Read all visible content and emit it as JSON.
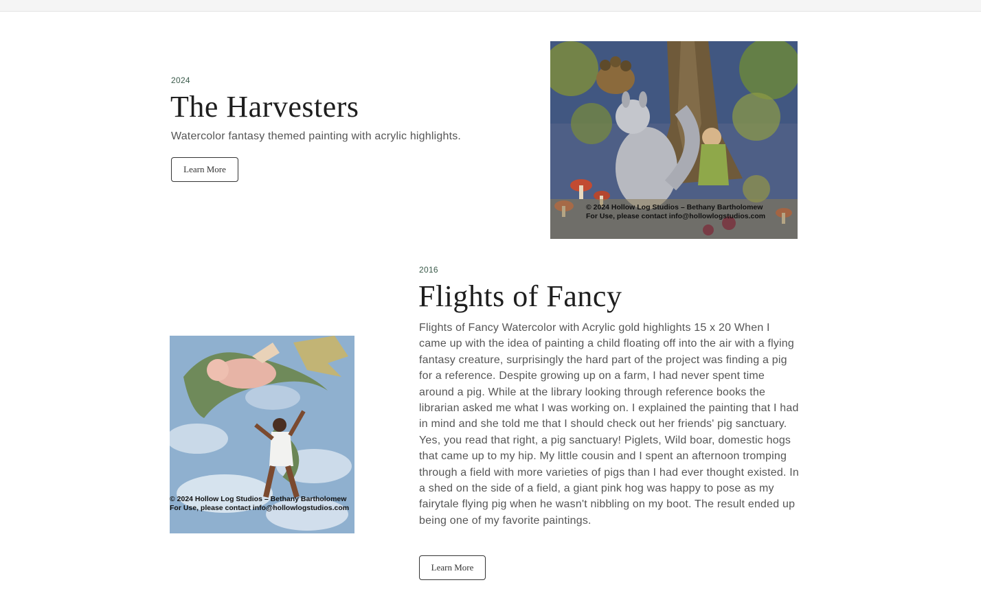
{
  "entries": [
    {
      "year": "2024",
      "title": "The Harvesters",
      "description": "Watercolor fantasy themed painting with acrylic highlights.",
      "button_label": "Learn More",
      "watermark_line1": "© 2024 Hollow Log Studios – Bethany Bartholomew",
      "watermark_line2": "For Use, please contact info@hollowlogstudios.com",
      "image_subject": "painting-harvesters"
    },
    {
      "year": "2016",
      "title": "Flights of Fancy",
      "description": "Flights of Fancy Watercolor with Acrylic gold highlights 15 x 20 When I came up with the idea of painting a child floating off into the air with a flying fantasy creature, surprisingly the hard part of the project was finding a pig for a reference. Despite growing up on a farm, I had never spent time around a pig. While at the library looking through reference books the librarian asked me what I was working on. I explained the painting that I had in mind and she told me that I should check out her friends' pig sanctuary. Yes, you read that right, a pig sanctuary! Piglets, Wild boar, domestic hogs that came up to my hip. My little cousin and I spent an afternoon tromping through a field with more varieties of pigs than I had ever thought existed. In a shed on the side of a field, a giant pink hog was happy to pose as my fairytale flying pig when he wasn't nibbling on my boot. The result ended up being one of my favorite paintings.",
      "button_label": "Learn More",
      "watermark_line1": "© 2024 Hollow Log Studios – Bethany Bartholomew",
      "watermark_line2": "For Use, please contact info@hollowlogstudios.com",
      "image_subject": "painting-flights-of-fancy"
    }
  ],
  "colors": {
    "year_text": "#3a5a4a",
    "title_text": "#1e1e1e",
    "body_text": "#555555",
    "button_border": "#333333"
  }
}
